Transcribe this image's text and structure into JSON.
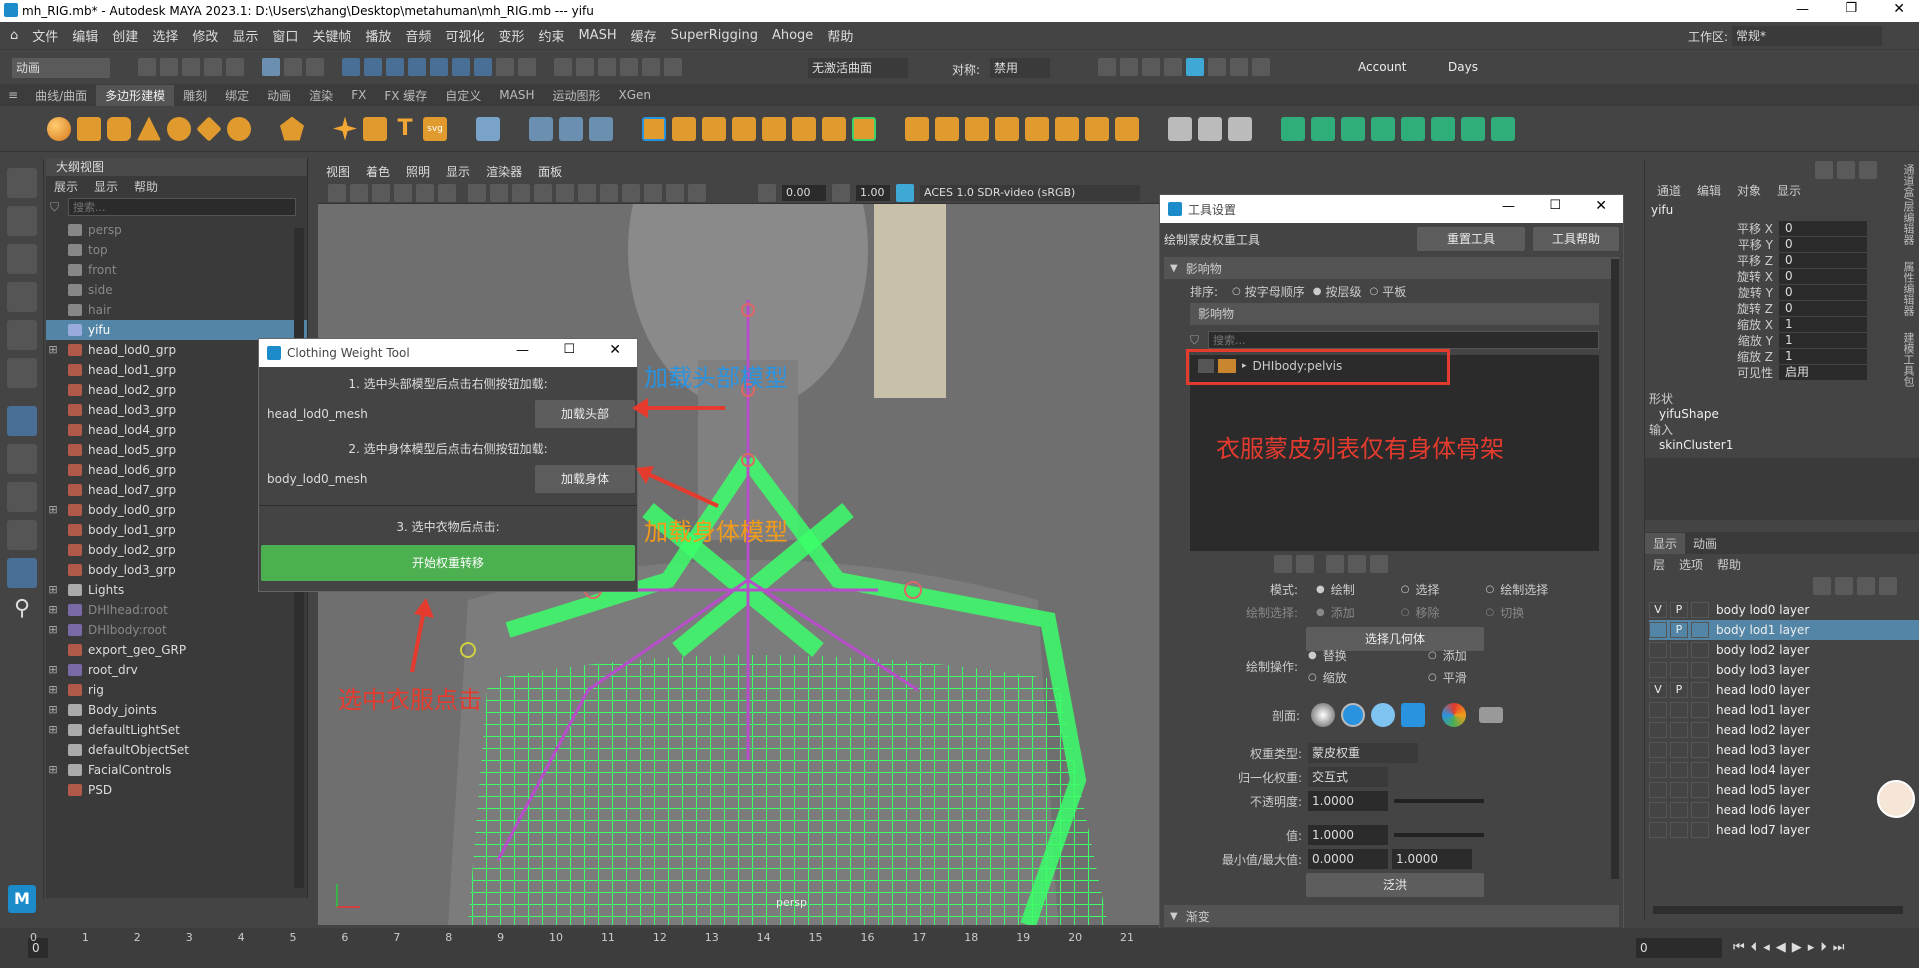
{
  "window": {
    "title": "mh_RIG.mb* - Autodesk MAYA 2023.1: D:\\Users\\zhang\\Desktop\\metahuman\\mh_RIG.mb   ---   yifu"
  },
  "menubar": [
    "文件",
    "编辑",
    "创建",
    "选择",
    "修改",
    "显示",
    "窗口",
    "关键帧",
    "播放",
    "音频",
    "可视化",
    "变形",
    "约束",
    "MASH",
    "缓存",
    "SuperRigging",
    "Ahoge",
    "帮助"
  ],
  "workspace": {
    "label": "工作区:",
    "value": "常规*"
  },
  "status": {
    "mode": "动画",
    "live_surface": "无激活曲面",
    "symmetry_label": "对称:",
    "symmetry_value": "禁用",
    "account": "Account",
    "days": "Days"
  },
  "shelf_tabs": [
    "曲线/曲面",
    "多边形建模",
    "雕刻",
    "绑定",
    "动画",
    "渲染",
    "FX",
    "FX 缓存",
    "自定义",
    "MASH",
    "运动图形",
    "XGen"
  ],
  "shelf_active": "多边形建模",
  "outliner": {
    "title": "大纲视图",
    "menu": [
      "展示",
      "显示",
      "帮助"
    ],
    "search_placeholder": "搜索...",
    "items": [
      {
        "label": "persp",
        "dim": true,
        "exp": ""
      },
      {
        "label": "top",
        "dim": true,
        "exp": ""
      },
      {
        "label": "front",
        "dim": true,
        "exp": ""
      },
      {
        "label": "side",
        "dim": true,
        "exp": ""
      },
      {
        "label": "hair",
        "dim": true,
        "exp": ""
      },
      {
        "label": "yifu",
        "sel": true,
        "exp": ""
      },
      {
        "label": "head_lod0_grp",
        "exp": "⊞"
      },
      {
        "label": "head_lod1_grp",
        "exp": ""
      },
      {
        "label": "head_lod2_grp",
        "exp": ""
      },
      {
        "label": "head_lod3_grp",
        "exp": ""
      },
      {
        "label": "head_lod4_grp",
        "exp": ""
      },
      {
        "label": "head_lod5_grp",
        "exp": ""
      },
      {
        "label": "head_lod6_grp",
        "exp": ""
      },
      {
        "label": "head_lod7_grp",
        "exp": ""
      },
      {
        "label": "body_lod0_grp",
        "exp": "⊞"
      },
      {
        "label": "body_lod1_grp",
        "exp": ""
      },
      {
        "label": "body_lod2_grp",
        "exp": ""
      },
      {
        "label": "body_lod3_grp",
        "exp": ""
      },
      {
        "label": "Lights",
        "exp": "⊞"
      },
      {
        "label": "DHIhead:root",
        "dim": true,
        "exp": "⊞"
      },
      {
        "label": "DHIbody:root",
        "dim": true,
        "exp": "⊞"
      },
      {
        "label": "export_geo_GRP",
        "exp": ""
      },
      {
        "label": "root_drv",
        "exp": "⊞"
      },
      {
        "label": "rig",
        "exp": "⊞"
      },
      {
        "label": "Body_joints",
        "exp": "⊞"
      },
      {
        "label": "defaultLightSet",
        "exp": "⊞"
      },
      {
        "label": "defaultObjectSet",
        "exp": ""
      },
      {
        "label": "FacialControls",
        "exp": "⊞"
      },
      {
        "label": "PSD",
        "exp": ""
      }
    ]
  },
  "viewport": {
    "menu": [
      "视图",
      "着色",
      "照明",
      "显示",
      "渲染器",
      "面板"
    ],
    "exposure": "0.00",
    "gamma": "1.00",
    "colorspace": "ACES 1.0 SDR-video (sRGB)",
    "camera": "persp"
  },
  "clothing_tool": {
    "title": "Clothing Weight Tool",
    "step1": "1. 选中头部模型后点击右侧按钮加载:",
    "head_value": "head_lod0_mesh",
    "head_button": "加载头部",
    "step2": "2. 选中身体模型后点击右侧按钮加载:",
    "body_value": "body_lod0_mesh",
    "body_button": "加载身体",
    "step3": "3. 选中衣物后点击:",
    "start_button": "开始权重转移"
  },
  "annotations": {
    "load_head": "加载头部模型",
    "load_body": "加载身体模型",
    "select_cloth": "选中衣服点击",
    "only_body": "衣服蒙皮列表仅有身体骨架"
  },
  "tool_settings": {
    "title": "工具设置",
    "tool_name": "绘制蒙皮权重工具",
    "reset_button": "重置工具",
    "help_button": "工具帮助",
    "influences_section": "影响物",
    "sort_label": "排序:",
    "sort_options": [
      "按字母顺序",
      "按层级",
      "平板"
    ],
    "influences_header": "影响物",
    "search_placeholder": "搜索...",
    "influence_item": "DHIbody:pelvis",
    "mode_label": "模式:",
    "mode_options": [
      "绘制",
      "选择",
      "绘制选择"
    ],
    "paint_select_label": "绘制选择:",
    "paint_select_options": [
      "添加",
      "移除",
      "切换"
    ],
    "select_geometry_button": "选择几何体",
    "paint_op_label": "绘制操作:",
    "paint_ops": [
      "替换",
      "添加",
      "缩放",
      "平滑"
    ],
    "profile_label": "剖面:",
    "weight_type_label": "权重类型:",
    "weight_type_value": "蒙皮权重",
    "normalize_label": "归一化权重:",
    "normalize_value": "交互式",
    "opacity_label": "不透明度:",
    "opacity_value": "1.0000",
    "value_label": "值:",
    "value_value": "1.0000",
    "minmax_label": "最小值/最大值:",
    "min_value": "0.0000",
    "max_value": "1.0000",
    "flood_button": "泛洪",
    "gradient_section": "渐变"
  },
  "channel_box": {
    "menu": [
      "通道",
      "编辑",
      "对象",
      "显示"
    ],
    "object": "yifu",
    "channels": [
      {
        "name": "平移 X",
        "value": "0"
      },
      {
        "name": "平移 Y",
        "value": "0"
      },
      {
        "name": "平移 Z",
        "value": "0"
      },
      {
        "name": "旋转 X",
        "value": "0"
      },
      {
        "name": "旋转 Y",
        "value": "0"
      },
      {
        "name": "旋转 Z",
        "value": "0"
      },
      {
        "name": "缩放 X",
        "value": "1"
      },
      {
        "name": "缩放 Y",
        "value": "1"
      },
      {
        "name": "缩放 Z",
        "value": "1"
      },
      {
        "name": "可见性",
        "value": "启用"
      }
    ],
    "shapes_label": "形状",
    "shape_name": "yifuShape",
    "inputs_label": "输入",
    "input_name": "skinCluster1"
  },
  "layer_editor": {
    "tabs": [
      "显示",
      "动画"
    ],
    "menu": [
      "层",
      "选项",
      "帮助"
    ],
    "layers": [
      {
        "v": "V",
        "p": "P",
        "name": "body lod0 layer"
      },
      {
        "v": "",
        "p": "P",
        "name": "body lod1 layer",
        "sel": true
      },
      {
        "v": "",
        "p": "",
        "name": "body lod2 layer"
      },
      {
        "v": "",
        "p": "",
        "name": "body lod3 layer"
      },
      {
        "v": "V",
        "p": "P",
        "name": "head lod0 layer"
      },
      {
        "v": "",
        "p": "",
        "name": "head lod1 layer"
      },
      {
        "v": "",
        "p": "",
        "name": "head lod2 layer"
      },
      {
        "v": "",
        "p": "",
        "name": "head lod3 layer"
      },
      {
        "v": "",
        "p": "",
        "name": "head lod4 layer"
      },
      {
        "v": "",
        "p": "",
        "name": "head lod5 layer"
      },
      {
        "v": "",
        "p": "",
        "name": "head lod6 layer"
      },
      {
        "v": "",
        "p": "",
        "name": "head lod7 layer"
      }
    ]
  },
  "side_tabs": [
    "通道盒/层编辑器",
    "属性编辑器",
    "建模工具包"
  ],
  "timeline": {
    "ticks": [
      "0",
      "1",
      "2",
      "3",
      "4",
      "5",
      "6",
      "7",
      "8",
      "9",
      "10",
      "11",
      "12",
      "13",
      "14",
      "15",
      "16",
      "17",
      "18",
      "19",
      "20",
      "21"
    ],
    "current_frame": "0"
  },
  "colors": {
    "accent": "#5285a6",
    "green_button": "#4caf50",
    "annotation_red": "#e53a2e",
    "annotation_blue": "#2a93e0",
    "annotation_orange": "#f29b1a",
    "wire_green": "#3cff6a"
  }
}
